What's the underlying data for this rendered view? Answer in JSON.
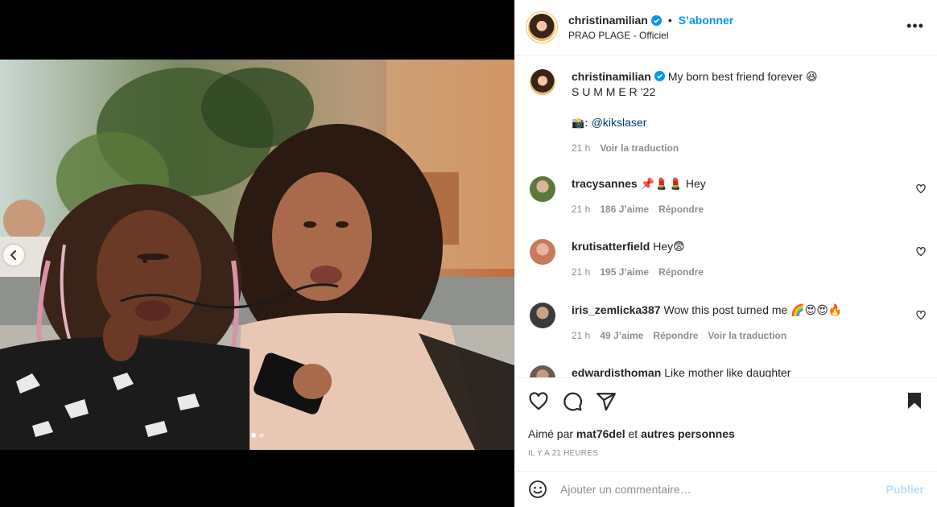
{
  "post": {
    "author": "christinamilian",
    "follow_label": "S’abonner",
    "bullet": "•",
    "location": "PRAO PLAGE - Officiel",
    "more_label": "•••"
  },
  "caption": {
    "username": "christinamilian",
    "line1": "My born best friend forever 😆",
    "line2": "S U M M E R ’22",
    "credit_prefix": "📸: ",
    "credit_mention": "@kikslaser",
    "time": "21 h",
    "translate": "Voir la traduction"
  },
  "comments": [
    {
      "username": "tracysannes",
      "text": "📌💄💄 Hey",
      "time": "21 h",
      "likes": "186 J’aime",
      "reply": "Répondre",
      "translate": ""
    },
    {
      "username": "krutisatterfield",
      "text": "Hey😨",
      "time": "21 h",
      "likes": "195 J’aime",
      "reply": "Répondre",
      "translate": ""
    },
    {
      "username": "iris_zemlicka387",
      "text": "Wow this post turned me 🌈😍😍🔥",
      "time": "21 h",
      "likes": "49 J’aime",
      "reply": "Répondre",
      "translate": "Voir la traduction"
    },
    {
      "username": "edwardisthoman",
      "text": "Like mother like daughter"
    }
  ],
  "actions": {
    "liked_by_prefix": "Aimé par ",
    "liked_by_user": "mat76del",
    "liked_by_mid": " et ",
    "liked_by_rest": "autres personnes",
    "timestamp": "IL Y A 21 HEURES"
  },
  "composer": {
    "emoji_icon": "smiley-icon",
    "placeholder": "Ajouter un commentaire…",
    "publish_label": "Publier"
  },
  "carousel": {
    "slides": 2,
    "active": 1
  },
  "colors": {
    "accent": "#0095f6",
    "publish_disabled": "#b2dffc",
    "muted": "#8e8e8e",
    "text": "#262626",
    "border": "#efefef"
  }
}
